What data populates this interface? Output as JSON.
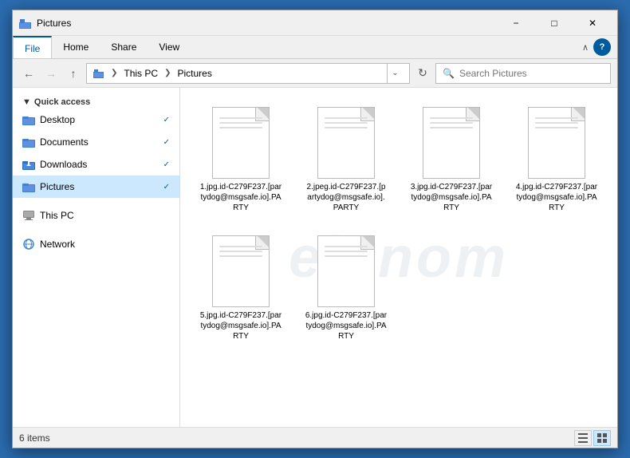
{
  "window": {
    "title": "Pictures",
    "title_icon": "📁"
  },
  "ribbon": {
    "tabs": [
      "File",
      "Home",
      "Share",
      "View"
    ],
    "active_tab": "File"
  },
  "address_bar": {
    "breadcrumb": [
      "This PC",
      "Pictures"
    ],
    "search_placeholder": "Search Pictures"
  },
  "sidebar": {
    "quick_access_label": "Quick access",
    "items": [
      {
        "id": "desktop",
        "label": "Desktop",
        "icon": "folder",
        "pinned": true
      },
      {
        "id": "documents",
        "label": "Documents",
        "icon": "folder",
        "pinned": true
      },
      {
        "id": "downloads",
        "label": "Downloads",
        "icon": "download-folder",
        "pinned": true
      },
      {
        "id": "pictures",
        "label": "Pictures",
        "icon": "folder",
        "pinned": true,
        "active": true
      }
    ],
    "other_items": [
      {
        "id": "this-pc",
        "label": "This PC",
        "icon": "pc"
      },
      {
        "id": "network",
        "label": "Network",
        "icon": "network"
      }
    ]
  },
  "files": [
    {
      "name": "1.jpg.id-C279F237.[partydog@msgsafe.io].PARTY"
    },
    {
      "name": "2.jpeg.id-C279F237.[partydog@msgsafe.io].PARTY"
    },
    {
      "name": "3.jpg.id-C279F237.[partydog@msgsafe.io].PARTY"
    },
    {
      "name": "4.jpg.id-C279F237.[partydog@msgsafe.io].PARTY"
    },
    {
      "name": "5.jpg.id-C279F237.[partydog@msgsafe.io].PARTY"
    },
    {
      "name": "6.jpg.id-C279F237.[partydog@msgsafe.io].PARTY"
    }
  ],
  "status": {
    "count_label": "6 items"
  },
  "watermark": "eisnom"
}
